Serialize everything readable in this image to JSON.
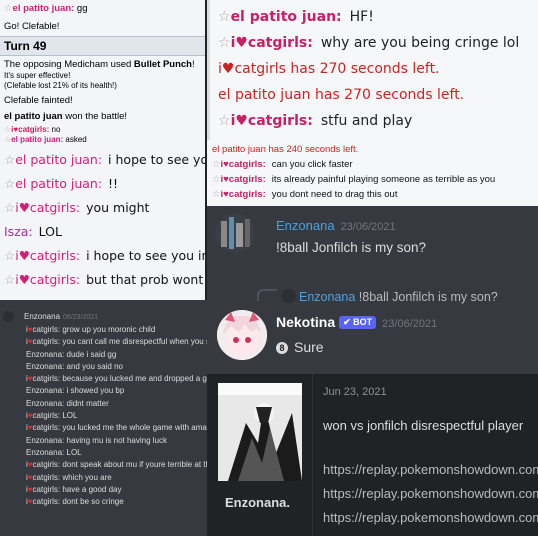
{
  "battle_log": {
    "line_gg": {
      "rank": "☆",
      "name": "el patito juan:",
      "msg": "gg"
    },
    "go": "Go! Clefable!",
    "turn": "Turn 49",
    "move_prefix": "The opposing Medicham used ",
    "move": "Bullet Punch",
    "move_suffix": "!",
    "effective": "It's super effective!",
    "lost": "(Clefable lost 21% of its health!)",
    "fainted": "Clefable fainted!",
    "winner_name": "el patito juan",
    "winner_suffix": " won the battle!",
    "chat_small": [
      {
        "rank": "☆",
        "name": "i♥catgirls:",
        "msg": "no"
      },
      {
        "rank": "☆",
        "name": "el patito juan:",
        "msg": "asked"
      }
    ],
    "chat_big": [
      {
        "rank": "☆",
        "name": "el patito juan:",
        "msg": "i hope to see you in retrocup",
        "color": "#cc2266"
      },
      {
        "rank": "☆",
        "name": "el patito juan:",
        "msg": "!!",
        "color": "#cc2266"
      },
      {
        "rank": "☆",
        "name": "i♥catgirls:",
        "msg": "you might",
        "color": "#cc1f5a"
      },
      {
        "rank": "",
        "name": "Isza:",
        "msg": "LOL",
        "color": "#a0309a"
      },
      {
        "rank": "☆",
        "name": "i♥catgirls:",
        "msg": "i hope to see you in a real tour someday",
        "color": "#cc1f5a"
      },
      {
        "rank": "☆",
        "name": "i♥catgirls:",
        "msg": "but that prob wont happen",
        "color": "#cc1f5a"
      }
    ]
  },
  "zoom_chat": {
    "r1": {
      "rank": "☆",
      "name": "el patito juan:",
      "msg": "HF!"
    },
    "r2": {
      "rank": "☆",
      "name": "i♥catgirls:",
      "msg": "why are you being cringe lol"
    },
    "r3": "i♥catgirls has 270 seconds left.",
    "r4": "el patito juan has 270 seconds left.",
    "r5": {
      "rank": "☆",
      "name": "i♥catgirls:",
      "msg": "stfu and play"
    }
  },
  "small_chat": {
    "timer": "el patito juan has 240 seconds left.",
    "rows": [
      {
        "rank": "☆",
        "name": "i♥catgirls:",
        "msg": "can you click faster"
      },
      {
        "rank": "☆",
        "name": "i♥catgirls:",
        "msg": "its already painful playing someone as terrible as you"
      },
      {
        "rank": "☆",
        "name": "i♥catgirls:",
        "msg": "you dont need to drag this out"
      }
    ]
  },
  "discord_msg": {
    "author": "Enzonana",
    "date": "23/06/2021",
    "message": "!8ball Jonfilch is my son?",
    "reply_author": "Enzonana",
    "reply_text": "!8ball Jonfilch is my son?",
    "bot_author": "Nekotina",
    "bot_badge": "✔ BOT",
    "bot_date": "23/06/2021",
    "bot_ball": "8",
    "bot_reply": "Sure"
  },
  "discord_log": {
    "author": "Enzonana",
    "date": "06/23/2021",
    "rows": [
      {
        "who": "i",
        "heart": true,
        "name": "catgirls:",
        "msg": "grow up you moronic child"
      },
      {
        "who": "i",
        "heart": true,
        "name": "catgirls:",
        "msg": "you cant call me disrespectful when you start the shittalk"
      },
      {
        "who": "Enzonana:",
        "heart": false,
        "name": "",
        "msg": "dude i said gg"
      },
      {
        "who": "Enzonana:",
        "heart": false,
        "name": "",
        "msg": "and you said no"
      },
      {
        "who": "i",
        "heart": true,
        "name": "catgirls:",
        "msg": "because you lucked me and dropped a gg"
      },
      {
        "who": "Enzonana:",
        "heart": false,
        "name": "",
        "msg": "i showed you bp"
      },
      {
        "who": "Enzonana:",
        "heart": false,
        "name": "",
        "msg": "didnt matter"
      },
      {
        "who": "i",
        "heart": true,
        "name": "catgirls:",
        "msg": "LOL"
      },
      {
        "who": "i",
        "heart": true,
        "name": "catgirls:",
        "msg": "you lucked me the whole game with amazing mu"
      },
      {
        "who": "Enzonana:",
        "heart": false,
        "name": "",
        "msg": "having mu is not having luck"
      },
      {
        "who": "Enzonana:",
        "heart": false,
        "name": "",
        "msg": "LOL"
      },
      {
        "who": "i",
        "heart": true,
        "name": "catgirls:",
        "msg": "dont speak about mu if youre terrible at the game"
      },
      {
        "who": "i",
        "heart": true,
        "name": "catgirls:",
        "msg": "which you are"
      },
      {
        "who": "i",
        "heart": true,
        "name": "catgirls:",
        "msg": "have a good day"
      },
      {
        "who": "i",
        "heart": true,
        "name": "catgirls:",
        "msg": "dont be so cringe"
      }
    ]
  },
  "replay_post": {
    "username": "Enzonana.",
    "date": "Jun 23, 2021",
    "title": "won vs jonfilch disrespectful player",
    "links": [
      "https://replay.pokemonshowdown.com",
      "https://replay.pokemonshowdown.com",
      "https://replay.pokemonshowdown.com"
    ]
  },
  "colors": {
    "showdown_name": "#cc2266",
    "discord_bg": "#36393f",
    "discord_link": "#4aa3e0",
    "bot_badge": "#5865f2"
  }
}
